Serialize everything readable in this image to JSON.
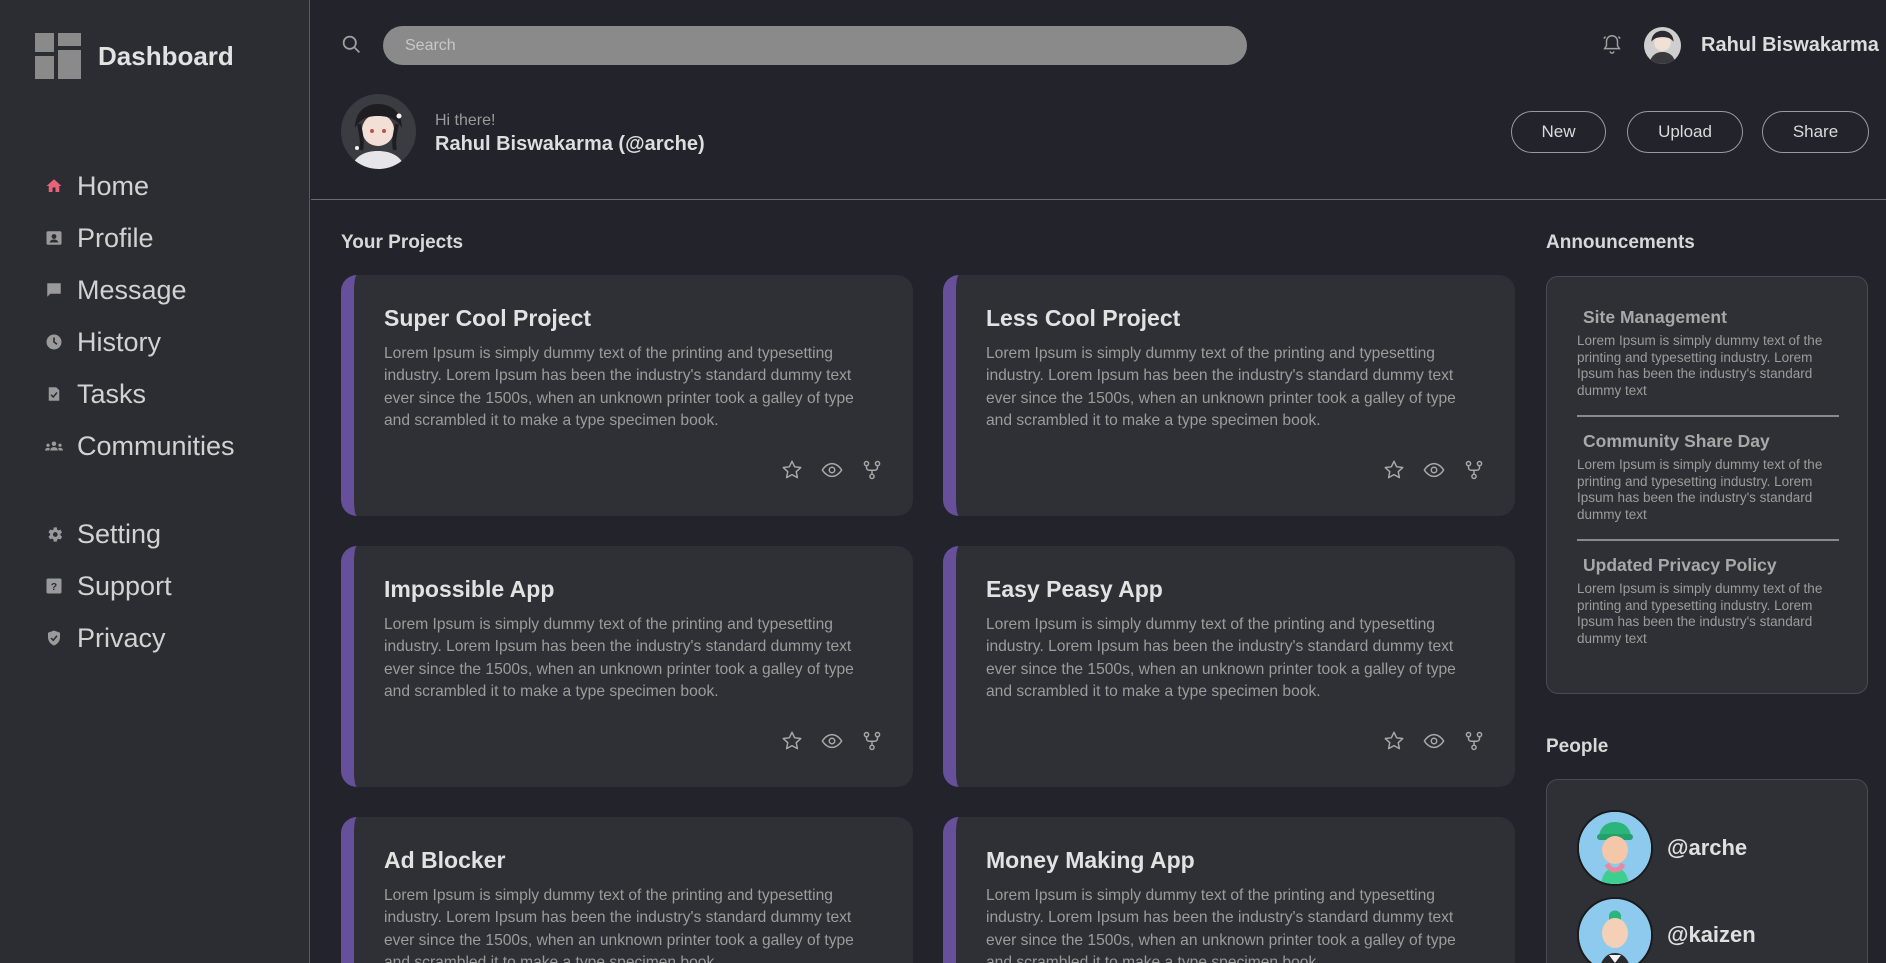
{
  "brand": {
    "title": "Dashboard"
  },
  "sidebar": {
    "main": [
      {
        "label": "Home",
        "icon": "home-icon"
      },
      {
        "label": "Profile",
        "icon": "profile-icon"
      },
      {
        "label": "Message",
        "icon": "message-icon"
      },
      {
        "label": "History",
        "icon": "history-icon"
      },
      {
        "label": "Tasks",
        "icon": "tasks-icon"
      },
      {
        "label": "Communities",
        "icon": "communities-icon"
      }
    ],
    "secondary": [
      {
        "label": "Setting",
        "icon": "gear-icon"
      },
      {
        "label": "Support",
        "icon": "help-icon"
      },
      {
        "label": "Privacy",
        "icon": "shield-icon"
      }
    ]
  },
  "search": {
    "placeholder": "Search"
  },
  "header": {
    "username": "Rahul Biswakarma",
    "greeting": "Hi there!",
    "full_name": "Rahul Biswakarma (@arche)",
    "buttons": {
      "new": "New",
      "upload": "Upload",
      "share": "Share"
    }
  },
  "projects": {
    "title": "Your Projects",
    "items": [
      {
        "title": "Super Cool Project",
        "desc": "Lorem Ipsum is simply dummy text of the printing and typesetting industry. Lorem Ipsum has been the industry's standard dummy text ever since the 1500s, when an unknown printer took a galley of type and scrambled it to make a type specimen book."
      },
      {
        "title": "Less Cool Project",
        "desc": "Lorem Ipsum is simply dummy text of the printing and typesetting industry. Lorem Ipsum has been the industry's standard dummy text ever since the 1500s, when an unknown printer took a galley of type and scrambled it to make a type specimen book."
      },
      {
        "title": "Impossible App",
        "desc": "Lorem Ipsum is simply dummy text of the printing and typesetting industry. Lorem Ipsum has been the industry's standard dummy text ever since the 1500s, when an unknown printer took a galley of type and scrambled it to make a type specimen book."
      },
      {
        "title": "Easy Peasy App",
        "desc": "Lorem Ipsum is simply dummy text of the printing and typesetting industry. Lorem Ipsum has been the industry's standard dummy text ever since the 1500s, when an unknown printer took a galley of type and scrambled it to make a type specimen book."
      },
      {
        "title": "Ad Blocker",
        "desc": "Lorem Ipsum is simply dummy text of the printing and typesetting industry. Lorem Ipsum has been the industry's standard dummy text ever since the 1500s, when an unknown printer took a galley of type and scrambled it to make a type specimen book."
      },
      {
        "title": "Money Making App",
        "desc": "Lorem Ipsum is simply dummy text of the printing and typesetting industry. Lorem Ipsum has been the industry's standard dummy text ever since the 1500s, when an unknown printer took a galley of type and scrambled it to make a type specimen book."
      }
    ]
  },
  "announcements": {
    "title": "Announcements",
    "items": [
      {
        "title": "Site Management",
        "text": "Lorem Ipsum is simply dummy text of the printing and typesetting industry. Lorem Ipsum has been the industry's standard dummy text"
      },
      {
        "title": "Community Share Day",
        "text": "Lorem Ipsum is simply dummy text of the printing and typesetting industry. Lorem Ipsum has been the industry's standard dummy text"
      },
      {
        "title": "Updated Privacy Policy",
        "text": "Lorem Ipsum is simply dummy text of the printing and typesetting industry. Lorem Ipsum has been the industry's standard dummy text"
      }
    ]
  },
  "people": {
    "title": "People",
    "items": [
      {
        "handle": "@arche"
      },
      {
        "handle": "@kaizen"
      }
    ]
  },
  "colors": {
    "accent": "#66509a",
    "home_icon": "#e8637a",
    "bg": "#22232b",
    "sidebar_bg": "#2b2d33",
    "card_bg": "#2e3036"
  }
}
